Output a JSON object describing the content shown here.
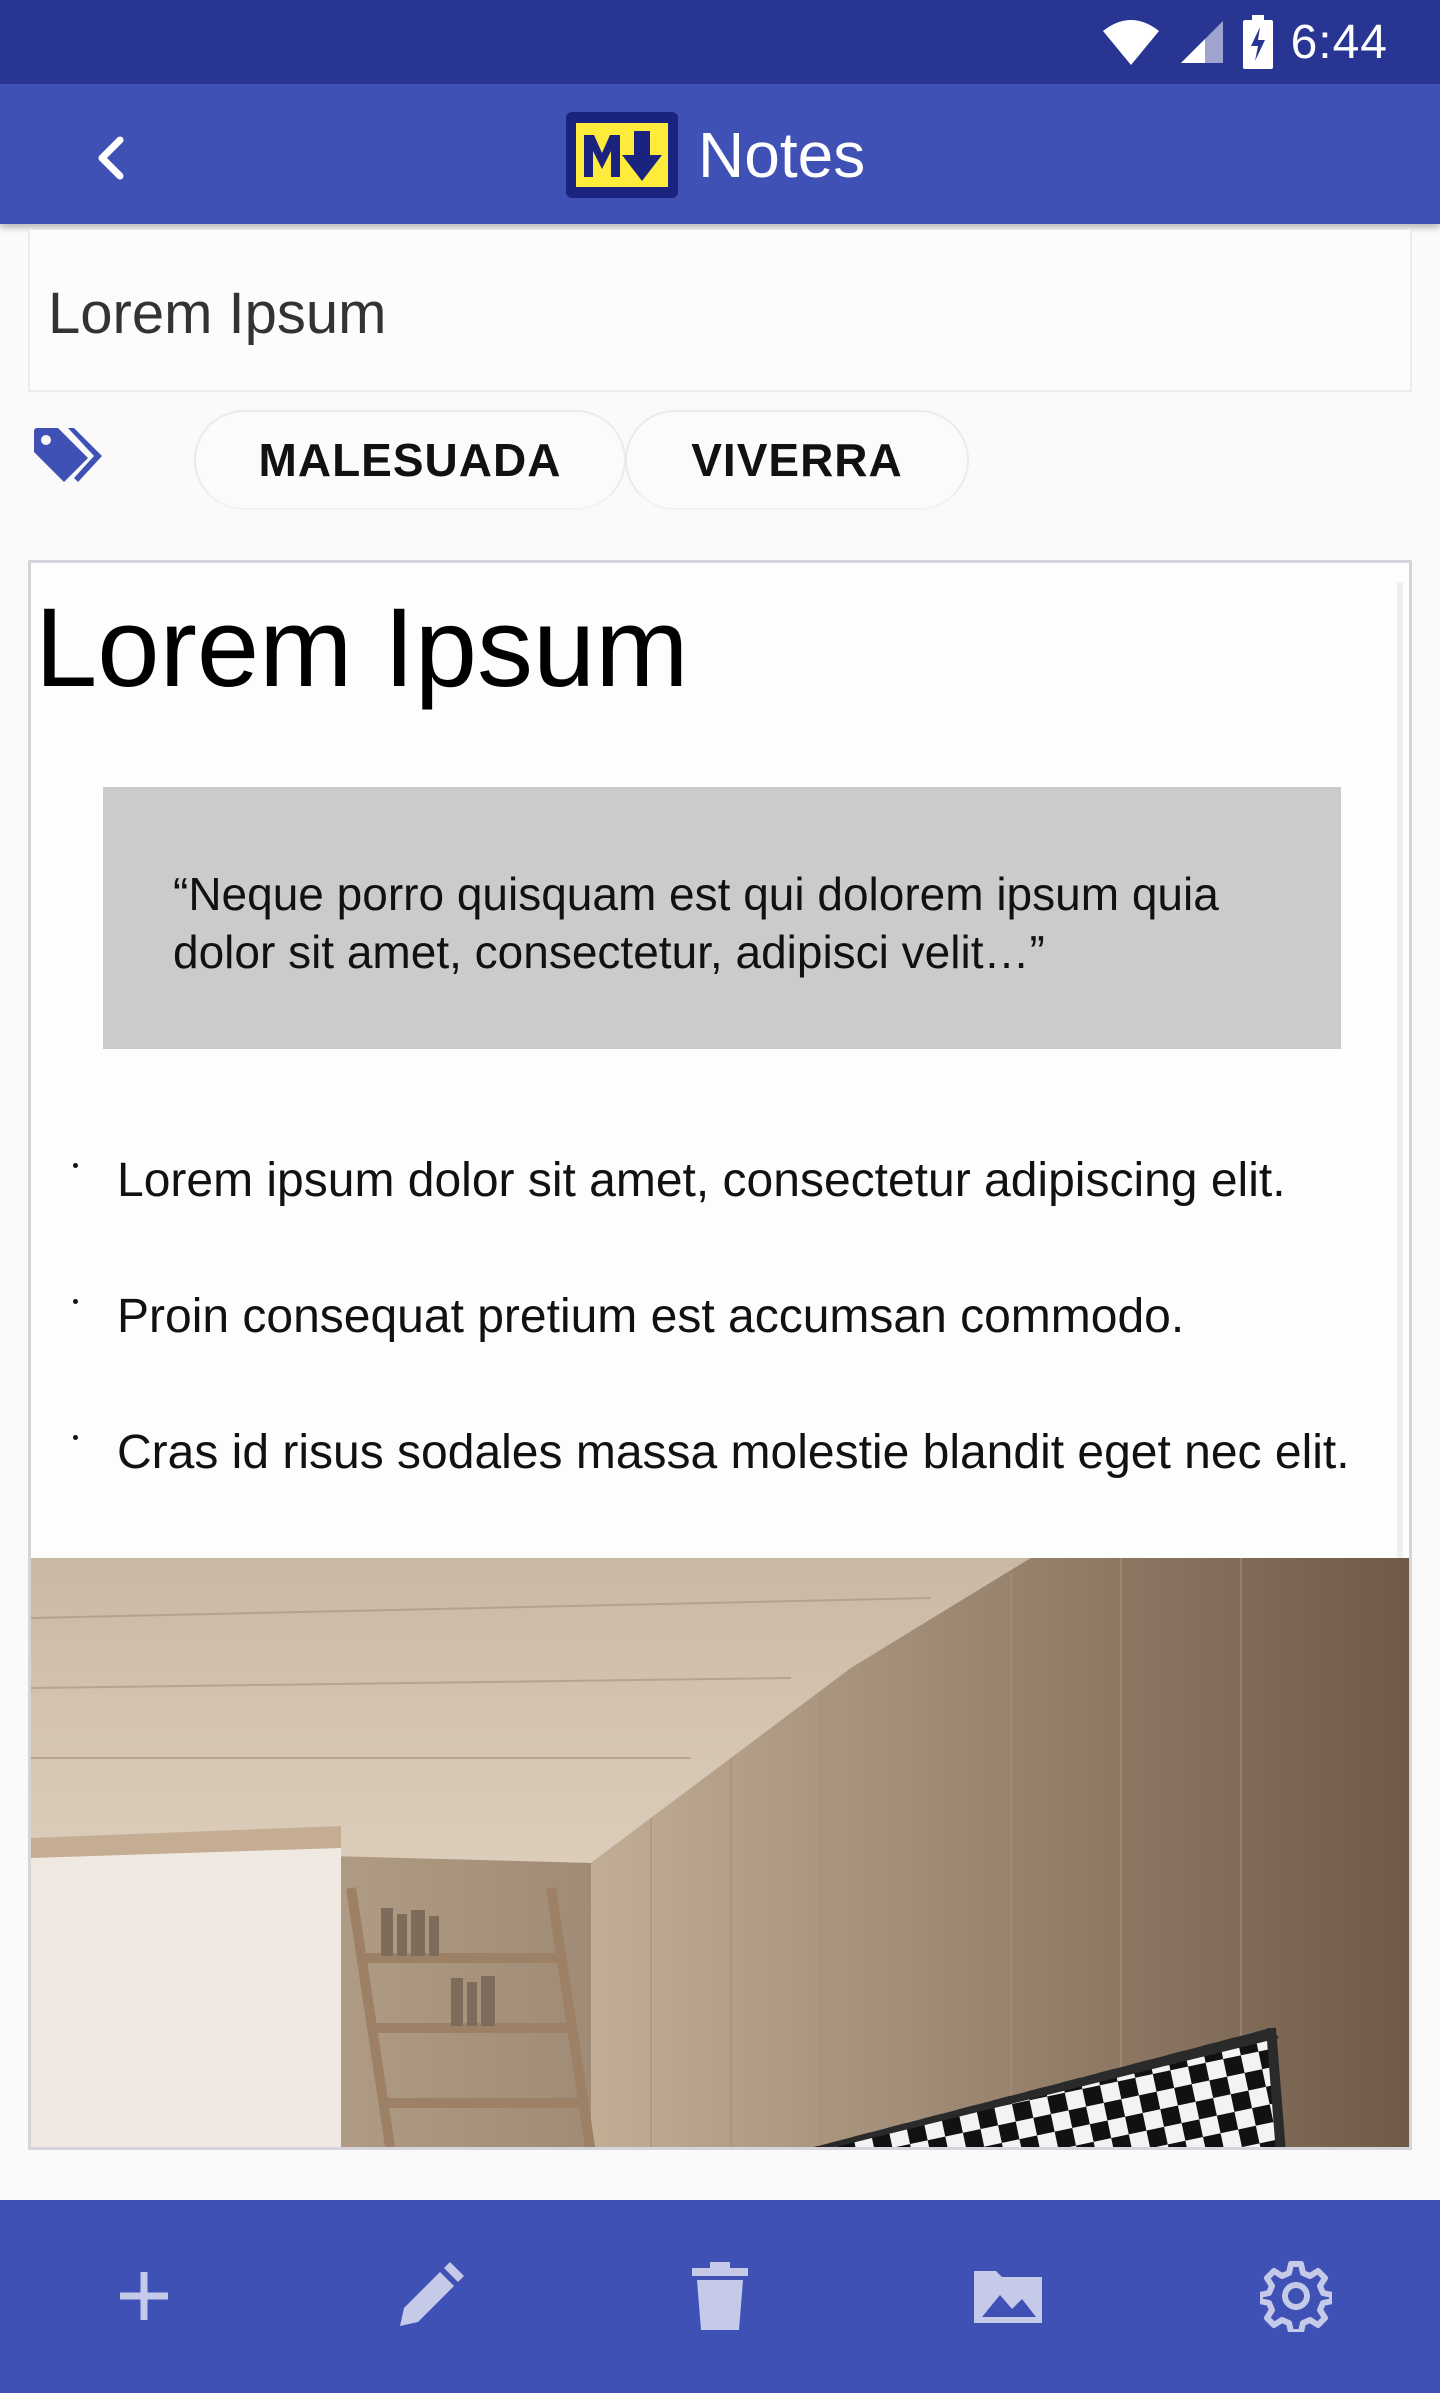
{
  "status_bar": {
    "time": "6:44",
    "icons": [
      "wifi-icon",
      "signal-icon",
      "battery-charging-icon"
    ]
  },
  "app_bar": {
    "back_icon": "chevron-left-icon",
    "logo_text": "M↓",
    "title": "Notes"
  },
  "note": {
    "title_value": "Lorem Ipsum",
    "tags_icon": "tags-icon",
    "tags": [
      "MALESUADA",
      "VIVERRA"
    ]
  },
  "preview": {
    "heading": "Lorem Ipsum",
    "quote": "“Neque porro quisquam est qui dolorem ipsum quia dolor sit amet, consectetur, adipisci velit…”",
    "bullets": [
      "Lorem ipsum dolor sit amet, consectetur adipiscing elit.",
      "Proin consequat pretium est accumsan commodo.",
      "Cras id risus sodales massa molestie blandit eget nec elit."
    ],
    "image": "room-interior-photo"
  },
  "bottom_bar": {
    "actions": [
      "plus-icon",
      "edit-icon",
      "delete-icon",
      "image-icon",
      "settings-icon"
    ]
  },
  "colors": {
    "status_bar": "#283593",
    "primary": "#3f51b5",
    "bottom_icons": "#c5cae9",
    "logo_yellow": "#ffeb3b",
    "logo_navy": "#1a237e"
  }
}
